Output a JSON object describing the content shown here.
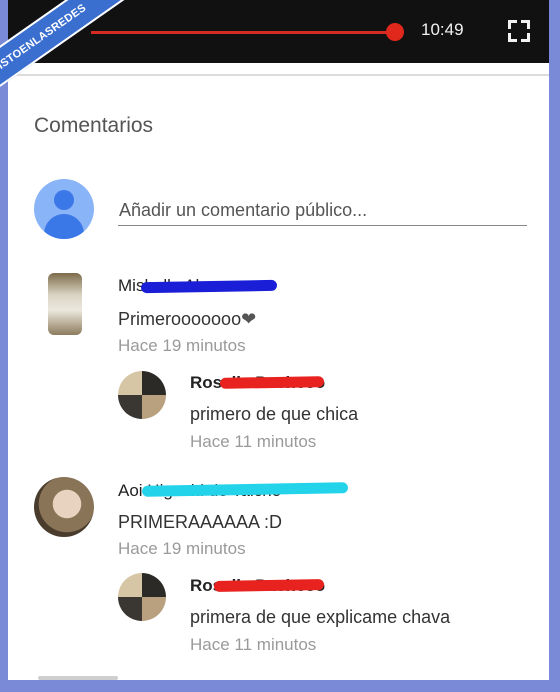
{
  "player": {
    "time": "10:49",
    "partial_digit": "9",
    "progress": 0.95,
    "icons": {
      "fullscreen": "fullscreen-icon"
    }
  },
  "watermark": {
    "text": "VISTOENLASREDES"
  },
  "comments_section": {
    "title": "Comentarios",
    "input_placeholder": "Añadir un comentario público..."
  },
  "comments": [
    {
      "author": "Mishelle Al",
      "text": "Primerooooooo",
      "heart": "❤",
      "time": "Hace 19 minutos",
      "reply": {
        "author": "Rosalia Pacheco",
        "text": "primero de que chica",
        "time": "Hace 11 minutos"
      }
    },
    {
      "author": "Aoi Higashi de Taicho",
      "text": "PRIMERAAAAAA :D",
      "time": "Hace 19 minutos",
      "reply": {
        "author": "Rosalia Pacheco",
        "text": "primera de que explicame chava",
        "time": "Hace 11 minutos"
      }
    }
  ],
  "colors": {
    "seek": "#e0281d",
    "scribble_blue": "#1a1ed6",
    "scribble_red": "#e8231f",
    "scribble_cyan": "#22d3ea",
    "page_border": "#7b8ad6"
  }
}
